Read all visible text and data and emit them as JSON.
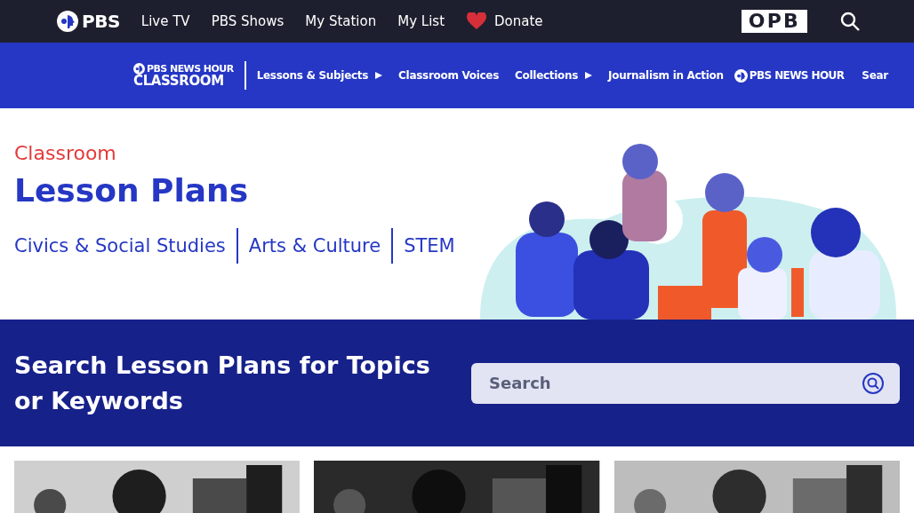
{
  "top_nav": {
    "logo": "PBS",
    "links": [
      {
        "label": "Live TV",
        "kind": "link"
      },
      {
        "label": "PBS Shows",
        "kind": "link"
      },
      {
        "label": "My Station",
        "kind": "link"
      },
      {
        "label": "My List",
        "kind": "link"
      },
      {
        "label": "Donate",
        "kind": "donate"
      }
    ],
    "station_logo": "OPB"
  },
  "sub_nav": {
    "logo_line_1": "PBS NEWS HOUR",
    "logo_line_2": "CLASSROOM",
    "items": [
      {
        "label": "Lessons & Subjects",
        "expandable": true
      },
      {
        "label": "Classroom Voices",
        "expandable": false
      },
      {
        "label": "Collections",
        "expandable": true
      },
      {
        "label": "Journalism in Action",
        "expandable": false
      }
    ],
    "brand": "PBS NEWS HOUR",
    "cut_item": "Sear"
  },
  "hero": {
    "eyebrow": "Classroom",
    "title": "Lesson Plans",
    "categories": [
      "Civics & Social Studies",
      "Arts & Culture",
      "STEM"
    ]
  },
  "search": {
    "heading": "Search Lesson Plans for Topics or Keywords",
    "placeholder": "Search"
  }
}
